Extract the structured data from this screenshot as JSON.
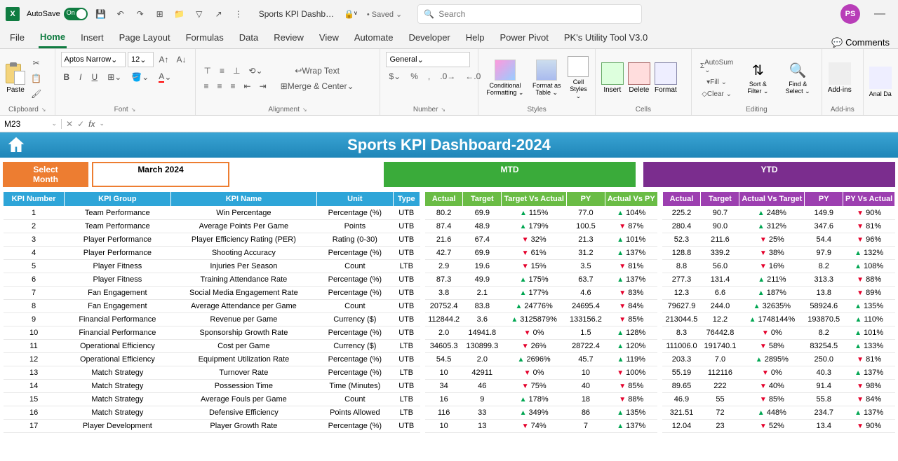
{
  "titlebar": {
    "autosave": "AutoSave",
    "toggle": "On",
    "filename": "Sports KPI Dashb…",
    "saved_indicator": "• Saved ⌄",
    "search_placeholder": "Search",
    "avatar": "PS"
  },
  "tabs": [
    "File",
    "Home",
    "Insert",
    "Page Layout",
    "Formulas",
    "Data",
    "Review",
    "View",
    "Automate",
    "Developer",
    "Help",
    "Power Pivot",
    "PK's Utility Tool V3.0"
  ],
  "comments_btn": "Comments",
  "ribbon": {
    "clipboard": {
      "label": "Clipboard",
      "paste": "Paste"
    },
    "font": {
      "label": "Font",
      "name": "Aptos Narrow",
      "size": "12",
      "bold": "B",
      "italic": "I",
      "underline": "U"
    },
    "alignment": {
      "label": "Alignment",
      "wrap": "Wrap Text",
      "merge": "Merge & Center"
    },
    "number": {
      "label": "Number",
      "format": "General"
    },
    "styles": {
      "label": "Styles",
      "cond": "Conditional Formatting ⌄",
      "fat": "Format as Table ⌄",
      "cell": "Cell Styles ⌄"
    },
    "cells": {
      "label": "Cells",
      "insert": "Insert",
      "delete": "Delete",
      "format": "Format"
    },
    "editing": {
      "label": "Editing",
      "autosum": "AutoSum ⌄",
      "fill": "Fill ⌄",
      "clear": "Clear ⌄",
      "sort": "Sort & Filter ⌄",
      "find": "Find & Select ⌄"
    },
    "addins": {
      "label": "Add-ins",
      "addins": "Add-ins",
      "analyze": "Anal Da"
    }
  },
  "namebox": "M23",
  "dashboard": {
    "title": "Sports KPI Dashboard-2024",
    "select_month": "Select Month",
    "month": "March 2024",
    "mtd": "MTD",
    "ytd": "YTD"
  },
  "headers": {
    "info": [
      "KPI Number",
      "KPI Group",
      "KPI Name",
      "Unit",
      "Type"
    ],
    "mtd": [
      "Actual",
      "Target",
      "Target Vs Actual",
      "PY",
      "Actual Vs PY"
    ],
    "ytd": [
      "Actual",
      "Target",
      "Actual Vs Target",
      "PY",
      "PY Vs Actual"
    ]
  },
  "rows": [
    {
      "n": 1,
      "g": "Team Performance",
      "name": "Win Percentage",
      "u": "Percentage (%)",
      "t": "UTB",
      "m": [
        "80.2",
        "69.9",
        "up",
        "115%",
        "77.0",
        "up",
        "104%"
      ],
      "y": [
        "225.2",
        "90.7",
        "up",
        "248%",
        "149.9",
        "dn",
        "90%"
      ]
    },
    {
      "n": 2,
      "g": "Team Performance",
      "name": "Average Points Per Game",
      "u": "Points",
      "t": "UTB",
      "m": [
        "87.4",
        "48.9",
        "up",
        "179%",
        "100.5",
        "dn",
        "87%"
      ],
      "y": [
        "280.4",
        "90.0",
        "up",
        "312%",
        "347.6",
        "dn",
        "81%"
      ]
    },
    {
      "n": 3,
      "g": "Player Performance",
      "name": "Player Efficiency Rating (PER)",
      "u": "Rating (0-30)",
      "t": "UTB",
      "m": [
        "21.6",
        "67.4",
        "dn",
        "32%",
        "21.3",
        "up",
        "101%"
      ],
      "y": [
        "52.3",
        "211.6",
        "dn",
        "25%",
        "54.4",
        "dn",
        "96%"
      ]
    },
    {
      "n": 4,
      "g": "Player Performance",
      "name": "Shooting Accuracy",
      "u": "Percentage (%)",
      "t": "UTB",
      "m": [
        "42.7",
        "69.9",
        "dn",
        "61%",
        "31.2",
        "up",
        "137%"
      ],
      "y": [
        "128.8",
        "339.2",
        "dn",
        "38%",
        "97.9",
        "up",
        "132%"
      ]
    },
    {
      "n": 5,
      "g": "Player Fitness",
      "name": "Injuries Per Season",
      "u": "Count",
      "t": "LTB",
      "m": [
        "2.9",
        "19.6",
        "dn",
        "15%",
        "3.5",
        "dn",
        "81%"
      ],
      "y": [
        "8.8",
        "56.0",
        "dn",
        "16%",
        "8.2",
        "up",
        "108%"
      ]
    },
    {
      "n": 6,
      "g": "Player Fitness",
      "name": "Training Attendance Rate",
      "u": "Percentage (%)",
      "t": "UTB",
      "m": [
        "87.3",
        "49.9",
        "up",
        "175%",
        "63.7",
        "up",
        "137%"
      ],
      "y": [
        "277.3",
        "131.4",
        "up",
        "211%",
        "313.3",
        "dn",
        "88%"
      ]
    },
    {
      "n": 7,
      "g": "Fan Engagement",
      "name": "Social Media Engagement Rate",
      "u": "Percentage (%)",
      "t": "UTB",
      "m": [
        "3.8",
        "2.1",
        "up",
        "177%",
        "4.6",
        "dn",
        "83%"
      ],
      "y": [
        "12.3",
        "6.6",
        "up",
        "187%",
        "13.8",
        "dn",
        "89%"
      ]
    },
    {
      "n": 8,
      "g": "Fan Engagement",
      "name": "Average Attendance per Game",
      "u": "Count",
      "t": "UTB",
      "m": [
        "20752.4",
        "83.8",
        "up",
        "24776%",
        "24695.4",
        "dn",
        "84%"
      ],
      "y": [
        "79627.9",
        "244.0",
        "up",
        "32635%",
        "58924.6",
        "up",
        "135%"
      ]
    },
    {
      "n": 9,
      "g": "Financial Performance",
      "name": "Revenue per Game",
      "u": "Currency ($)",
      "t": "UTB",
      "m": [
        "112844.2",
        "3.6",
        "up",
        "3125879%",
        "133156.2",
        "dn",
        "85%"
      ],
      "y": [
        "213044.5",
        "12.2",
        "up",
        "1748144%",
        "193870.5",
        "up",
        "110%"
      ]
    },
    {
      "n": 10,
      "g": "Financial Performance",
      "name": "Sponsorship Growth Rate",
      "u": "Percentage (%)",
      "t": "UTB",
      "m": [
        "2.0",
        "14941.8",
        "dn",
        "0%",
        "1.5",
        "up",
        "128%"
      ],
      "y": [
        "8.3",
        "76442.8",
        "dn",
        "0%",
        "8.2",
        "up",
        "101%"
      ]
    },
    {
      "n": 11,
      "g": "Operational Efficiency",
      "name": "Cost per Game",
      "u": "Currency ($)",
      "t": "LTB",
      "m": [
        "34605.3",
        "130899.3",
        "dn",
        "26%",
        "28722.4",
        "up",
        "120%"
      ],
      "y": [
        "111006.0",
        "191740.1",
        "dn",
        "58%",
        "83254.5",
        "up",
        "133%"
      ]
    },
    {
      "n": 12,
      "g": "Operational Efficiency",
      "name": "Equipment Utilization Rate",
      "u": "Percentage (%)",
      "t": "UTB",
      "m": [
        "54.5",
        "2.0",
        "up",
        "2696%",
        "45.7",
        "up",
        "119%"
      ],
      "y": [
        "203.3",
        "7.0",
        "up",
        "2895%",
        "250.0",
        "dn",
        "81%"
      ]
    },
    {
      "n": 13,
      "g": "Match Strategy",
      "name": "Turnover Rate",
      "u": "Percentage (%)",
      "t": "LTB",
      "m": [
        "10",
        "42911",
        "dn",
        "0%",
        "10",
        "dn",
        "100%"
      ],
      "y": [
        "55.19",
        "112116",
        "dn",
        "0%",
        "40.3",
        "up",
        "137%"
      ]
    },
    {
      "n": 14,
      "g": "Match Strategy",
      "name": "Possession Time",
      "u": "Time (Minutes)",
      "t": "UTB",
      "m": [
        "34",
        "46",
        "dn",
        "75%",
        "40",
        "dn",
        "85%"
      ],
      "y": [
        "89.65",
        "222",
        "dn",
        "40%",
        "91.4",
        "dn",
        "98%"
      ]
    },
    {
      "n": 15,
      "g": "Match Strategy",
      "name": "Average Fouls per Game",
      "u": "Count",
      "t": "LTB",
      "m": [
        "16",
        "9",
        "up",
        "178%",
        "18",
        "dn",
        "88%"
      ],
      "y": [
        "46.9",
        "55",
        "dn",
        "85%",
        "55.8",
        "dn",
        "84%"
      ]
    },
    {
      "n": 16,
      "g": "Match Strategy",
      "name": "Defensive Efficiency",
      "u": "Points Allowed",
      "t": "LTB",
      "m": [
        "116",
        "33",
        "up",
        "349%",
        "86",
        "up",
        "135%"
      ],
      "y": [
        "321.51",
        "72",
        "up",
        "448%",
        "234.7",
        "up",
        "137%"
      ]
    },
    {
      "n": 17,
      "g": "Player Development",
      "name": "Player Growth Rate",
      "u": "Percentage (%)",
      "t": "UTB",
      "m": [
        "10",
        "13",
        "dn",
        "74%",
        "7",
        "up",
        "137%"
      ],
      "y": [
        "12.04",
        "23",
        "dn",
        "52%",
        "13.4",
        "dn",
        "90%"
      ]
    }
  ]
}
